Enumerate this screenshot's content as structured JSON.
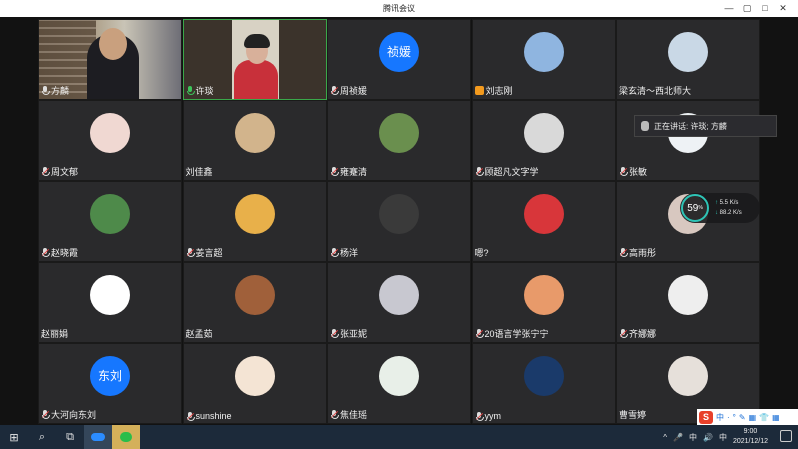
{
  "window": {
    "title": "腾讯会议",
    "controls": [
      "—",
      "▢",
      "□",
      "✕"
    ]
  },
  "participants": [
    {
      "name": "方麟",
      "type": "video",
      "mic": "on"
    },
    {
      "name": "许琰",
      "type": "video",
      "mic": "green"
    },
    {
      "name": "周祯媛",
      "type": "text-avatar",
      "avatar_text": "祯媛",
      "mic": "muted"
    },
    {
      "name": "刘志刚",
      "type": "image-avatar",
      "avatar_color": "#8fb5e0",
      "mic": "host"
    },
    {
      "name": "梁玄清～西北师大",
      "type": "image-avatar",
      "avatar_color": "#c9d8e6",
      "mic": "none"
    },
    {
      "name": "周文郁",
      "type": "image-avatar",
      "avatar_color": "#f0d8d2",
      "mic": "muted"
    },
    {
      "name": "刘佳鑫",
      "type": "image-avatar",
      "avatar_color": "#d2b48c",
      "mic": "none"
    },
    {
      "name": "雍蹇清",
      "type": "image-avatar",
      "avatar_color": "#6a8f4e",
      "mic": "muted"
    },
    {
      "name": "顾超凡文字学",
      "type": "image-avatar",
      "avatar_color": "#d9d9d9",
      "mic": "muted"
    },
    {
      "name": "张敏",
      "type": "image-avatar",
      "avatar_color": "#eef2f5",
      "mic": "muted"
    },
    {
      "name": "赵晓霞",
      "type": "image-avatar",
      "avatar_color": "#4e8a4a",
      "mic": "muted"
    },
    {
      "name": "姜言超",
      "type": "image-avatar",
      "avatar_color": "#e8b04a",
      "mic": "muted"
    },
    {
      "name": "杨洋",
      "type": "image-avatar",
      "avatar_color": "#3a3a3a",
      "mic": "muted"
    },
    {
      "name": "嗯?",
      "type": "image-avatar",
      "avatar_color": "#d8363a",
      "mic": "none"
    },
    {
      "name": "高雨彤",
      "type": "image-avatar",
      "avatar_color": "#d8c8c0",
      "mic": "muted"
    },
    {
      "name": "赵丽娟",
      "type": "image-avatar",
      "avatar_color": "#ffffff",
      "mic": "none"
    },
    {
      "name": "赵孟茹",
      "type": "image-avatar",
      "avatar_color": "#a0603a",
      "mic": "none"
    },
    {
      "name": "张亚妮",
      "type": "image-avatar",
      "avatar_color": "#c8c8d0",
      "mic": "muted"
    },
    {
      "name": "20语言学张宁宁",
      "type": "image-avatar",
      "avatar_color": "#e89a6a",
      "mic": "muted"
    },
    {
      "name": "齐娜娜",
      "type": "image-avatar",
      "avatar_color": "#eeeeee",
      "mic": "muted"
    },
    {
      "name": "大河向东刘",
      "type": "text-avatar",
      "avatar_text": "东刘",
      "mic": "muted"
    },
    {
      "name": "sunshine",
      "type": "image-avatar",
      "avatar_color": "#f4e4d4",
      "mic": "muted"
    },
    {
      "name": "焦佳瑶",
      "type": "image-avatar",
      "avatar_color": "#e8efe8",
      "mic": "muted"
    },
    {
      "name": "yym",
      "type": "image-avatar",
      "avatar_color": "#1a3a6a",
      "mic": "muted"
    },
    {
      "name": "曹雪婷",
      "type": "image-avatar",
      "avatar_color": "#e6e0da",
      "mic": "none"
    }
  ],
  "speaking": {
    "text": "正在讲话: 许琰; 方麟"
  },
  "network": {
    "percent": "59",
    "unit": "%",
    "upload": "5.5",
    "download": "88.2",
    "rate_unit": "K/s"
  },
  "ime": {
    "logo": "S",
    "mode": "中",
    "icons": [
      "·",
      "°",
      "✎",
      "▦",
      "👕",
      "▦"
    ]
  },
  "taskbar": {
    "start_icon": "windows-icon",
    "clock_time": "9:00",
    "clock_date": "2021/12/12",
    "tray_icons": [
      "^",
      "🎤",
      "中",
      "🔊",
      "中"
    ]
  }
}
